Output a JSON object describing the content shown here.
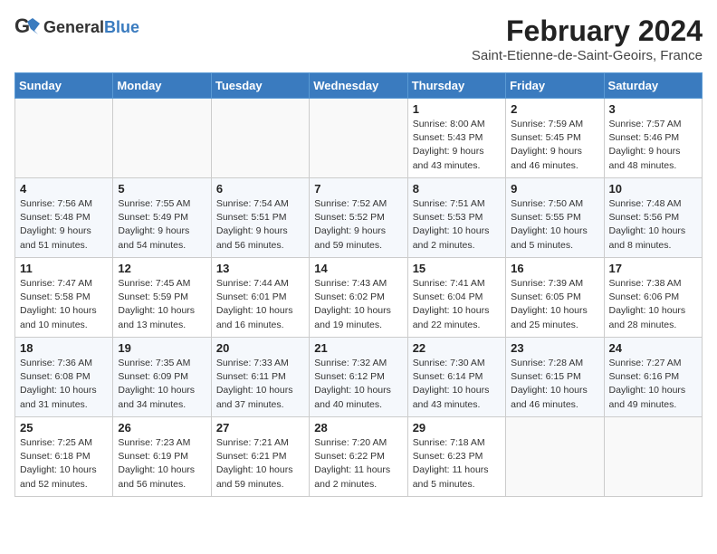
{
  "header": {
    "logo_general": "General",
    "logo_blue": "Blue",
    "month_year": "February 2024",
    "location": "Saint-Etienne-de-Saint-Geoirs, France"
  },
  "columns": [
    "Sunday",
    "Monday",
    "Tuesday",
    "Wednesday",
    "Thursday",
    "Friday",
    "Saturday"
  ],
  "weeks": [
    [
      {
        "day": "",
        "info": ""
      },
      {
        "day": "",
        "info": ""
      },
      {
        "day": "",
        "info": ""
      },
      {
        "day": "",
        "info": ""
      },
      {
        "day": "1",
        "info": "Sunrise: 8:00 AM\nSunset: 5:43 PM\nDaylight: 9 hours\nand 43 minutes."
      },
      {
        "day": "2",
        "info": "Sunrise: 7:59 AM\nSunset: 5:45 PM\nDaylight: 9 hours\nand 46 minutes."
      },
      {
        "day": "3",
        "info": "Sunrise: 7:57 AM\nSunset: 5:46 PM\nDaylight: 9 hours\nand 48 minutes."
      }
    ],
    [
      {
        "day": "4",
        "info": "Sunrise: 7:56 AM\nSunset: 5:48 PM\nDaylight: 9 hours\nand 51 minutes."
      },
      {
        "day": "5",
        "info": "Sunrise: 7:55 AM\nSunset: 5:49 PM\nDaylight: 9 hours\nand 54 minutes."
      },
      {
        "day": "6",
        "info": "Sunrise: 7:54 AM\nSunset: 5:51 PM\nDaylight: 9 hours\nand 56 minutes."
      },
      {
        "day": "7",
        "info": "Sunrise: 7:52 AM\nSunset: 5:52 PM\nDaylight: 9 hours\nand 59 minutes."
      },
      {
        "day": "8",
        "info": "Sunrise: 7:51 AM\nSunset: 5:53 PM\nDaylight: 10 hours\nand 2 minutes."
      },
      {
        "day": "9",
        "info": "Sunrise: 7:50 AM\nSunset: 5:55 PM\nDaylight: 10 hours\nand 5 minutes."
      },
      {
        "day": "10",
        "info": "Sunrise: 7:48 AM\nSunset: 5:56 PM\nDaylight: 10 hours\nand 8 minutes."
      }
    ],
    [
      {
        "day": "11",
        "info": "Sunrise: 7:47 AM\nSunset: 5:58 PM\nDaylight: 10 hours\nand 10 minutes."
      },
      {
        "day": "12",
        "info": "Sunrise: 7:45 AM\nSunset: 5:59 PM\nDaylight: 10 hours\nand 13 minutes."
      },
      {
        "day": "13",
        "info": "Sunrise: 7:44 AM\nSunset: 6:01 PM\nDaylight: 10 hours\nand 16 minutes."
      },
      {
        "day": "14",
        "info": "Sunrise: 7:43 AM\nSunset: 6:02 PM\nDaylight: 10 hours\nand 19 minutes."
      },
      {
        "day": "15",
        "info": "Sunrise: 7:41 AM\nSunset: 6:04 PM\nDaylight: 10 hours\nand 22 minutes."
      },
      {
        "day": "16",
        "info": "Sunrise: 7:39 AM\nSunset: 6:05 PM\nDaylight: 10 hours\nand 25 minutes."
      },
      {
        "day": "17",
        "info": "Sunrise: 7:38 AM\nSunset: 6:06 PM\nDaylight: 10 hours\nand 28 minutes."
      }
    ],
    [
      {
        "day": "18",
        "info": "Sunrise: 7:36 AM\nSunset: 6:08 PM\nDaylight: 10 hours\nand 31 minutes."
      },
      {
        "day": "19",
        "info": "Sunrise: 7:35 AM\nSunset: 6:09 PM\nDaylight: 10 hours\nand 34 minutes."
      },
      {
        "day": "20",
        "info": "Sunrise: 7:33 AM\nSunset: 6:11 PM\nDaylight: 10 hours\nand 37 minutes."
      },
      {
        "day": "21",
        "info": "Sunrise: 7:32 AM\nSunset: 6:12 PM\nDaylight: 10 hours\nand 40 minutes."
      },
      {
        "day": "22",
        "info": "Sunrise: 7:30 AM\nSunset: 6:14 PM\nDaylight: 10 hours\nand 43 minutes."
      },
      {
        "day": "23",
        "info": "Sunrise: 7:28 AM\nSunset: 6:15 PM\nDaylight: 10 hours\nand 46 minutes."
      },
      {
        "day": "24",
        "info": "Sunrise: 7:27 AM\nSunset: 6:16 PM\nDaylight: 10 hours\nand 49 minutes."
      }
    ],
    [
      {
        "day": "25",
        "info": "Sunrise: 7:25 AM\nSunset: 6:18 PM\nDaylight: 10 hours\nand 52 minutes."
      },
      {
        "day": "26",
        "info": "Sunrise: 7:23 AM\nSunset: 6:19 PM\nDaylight: 10 hours\nand 56 minutes."
      },
      {
        "day": "27",
        "info": "Sunrise: 7:21 AM\nSunset: 6:21 PM\nDaylight: 10 hours\nand 59 minutes."
      },
      {
        "day": "28",
        "info": "Sunrise: 7:20 AM\nSunset: 6:22 PM\nDaylight: 11 hours\nand 2 minutes."
      },
      {
        "day": "29",
        "info": "Sunrise: 7:18 AM\nSunset: 6:23 PM\nDaylight: 11 hours\nand 5 minutes."
      },
      {
        "day": "",
        "info": ""
      },
      {
        "day": "",
        "info": ""
      }
    ]
  ]
}
